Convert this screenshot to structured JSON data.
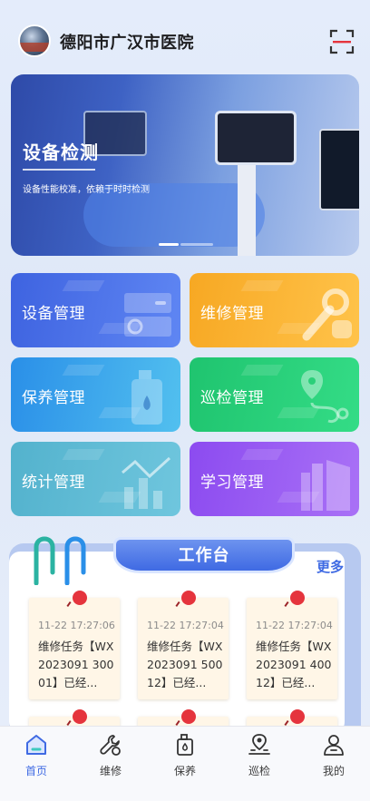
{
  "header": {
    "title": "德阳市广汉市医院"
  },
  "banner": {
    "title": "设备检测",
    "subtitle": "设备性能校准，依赖于时时检测"
  },
  "modules": [
    {
      "label": "设备管理"
    },
    {
      "label": "维修管理"
    },
    {
      "label": "保养管理"
    },
    {
      "label": "巡检管理"
    },
    {
      "label": "统计管理"
    },
    {
      "label": "学习管理"
    }
  ],
  "workbench": {
    "title": "工作台",
    "more": "更多",
    "notes": [
      {
        "time": "11-22 17:27:06",
        "text": "维修任务【WX2023091 30001】已经..."
      },
      {
        "time": "11-22 17:27:04",
        "text": "维修任务【WX2023091 50012】已经..."
      },
      {
        "time": "11-22 17:27:04",
        "text": "维修任务【WX2023091 40012】已经..."
      }
    ]
  },
  "tabbar": [
    {
      "label": "首页",
      "icon": "home-icon",
      "active": true
    },
    {
      "label": "维修",
      "icon": "wrench-icon"
    },
    {
      "label": "保养",
      "icon": "oil-can-icon"
    },
    {
      "label": "巡检",
      "icon": "map-pin-icon"
    },
    {
      "label": "我的",
      "icon": "user-icon"
    }
  ],
  "colors": {
    "accent": "#3f6ae3",
    "pin": "#e5343d",
    "note_bg": "#fff6e7"
  }
}
